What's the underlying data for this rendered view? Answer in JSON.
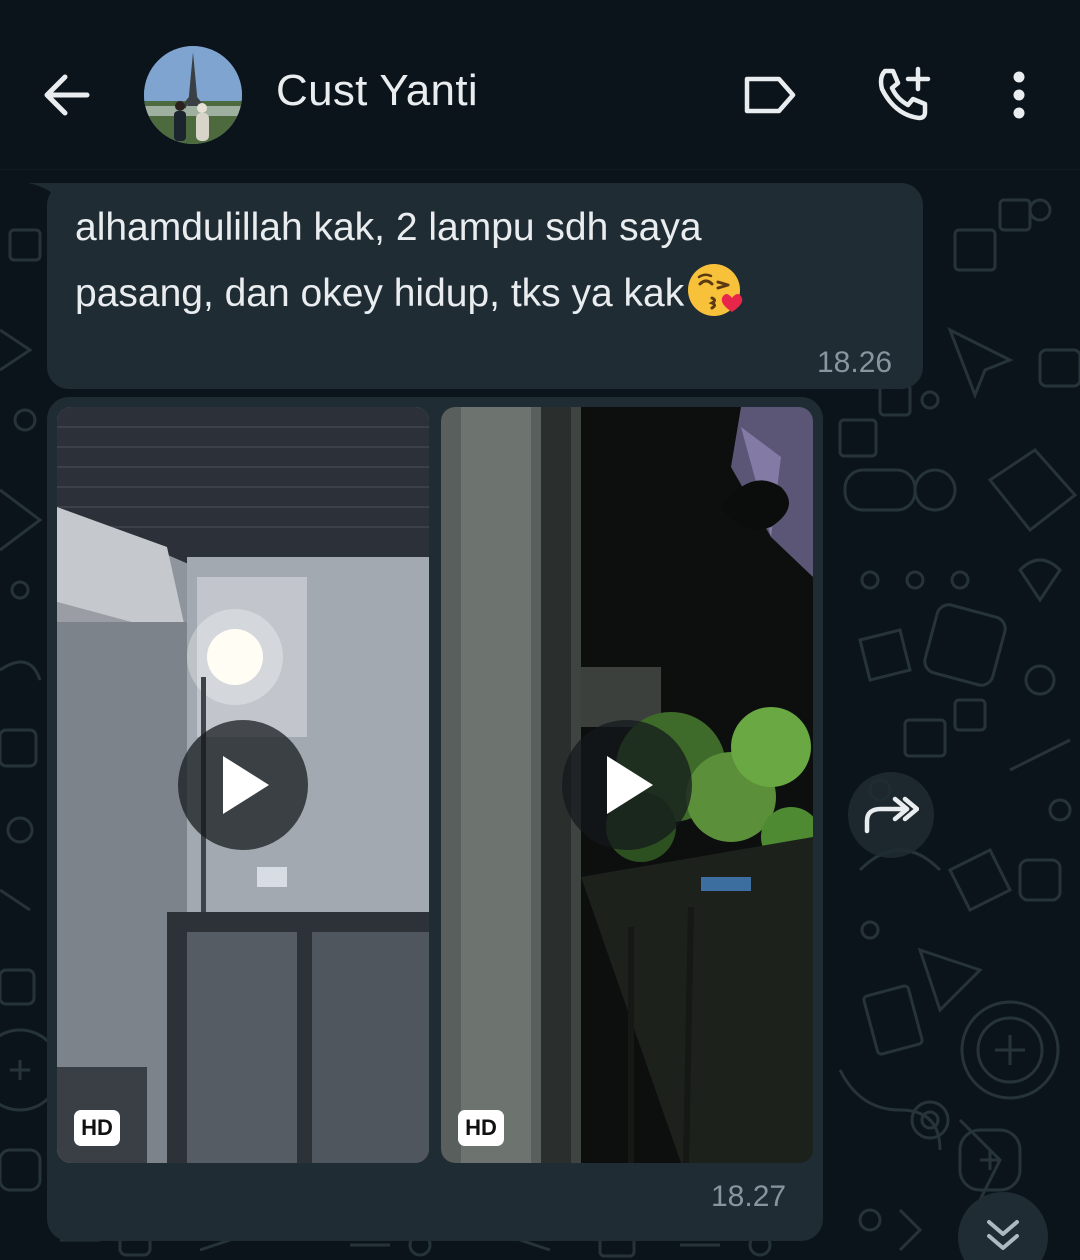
{
  "header": {
    "contact_name": "Cust Yanti",
    "icons": [
      "back-arrow-icon",
      "label-tag-icon",
      "add-call-icon",
      "more-vertical-icon"
    ]
  },
  "messages": [
    {
      "type": "text",
      "text": "alhamdulillah kak, 2 lampu sdh saya pasang, dan okey hidup, tks ya kak",
      "emoji": "face-blowing-kiss-emoji",
      "time": "18.26"
    },
    {
      "type": "media-album",
      "items": [
        {
          "kind": "video",
          "badge": "HD"
        },
        {
          "kind": "video",
          "badge": "HD"
        }
      ],
      "time": "18.27"
    }
  ],
  "colors": {
    "background": "#0b141a",
    "bubble": "#202c33",
    "text": "#e9edef",
    "meta": "#8696a0"
  }
}
